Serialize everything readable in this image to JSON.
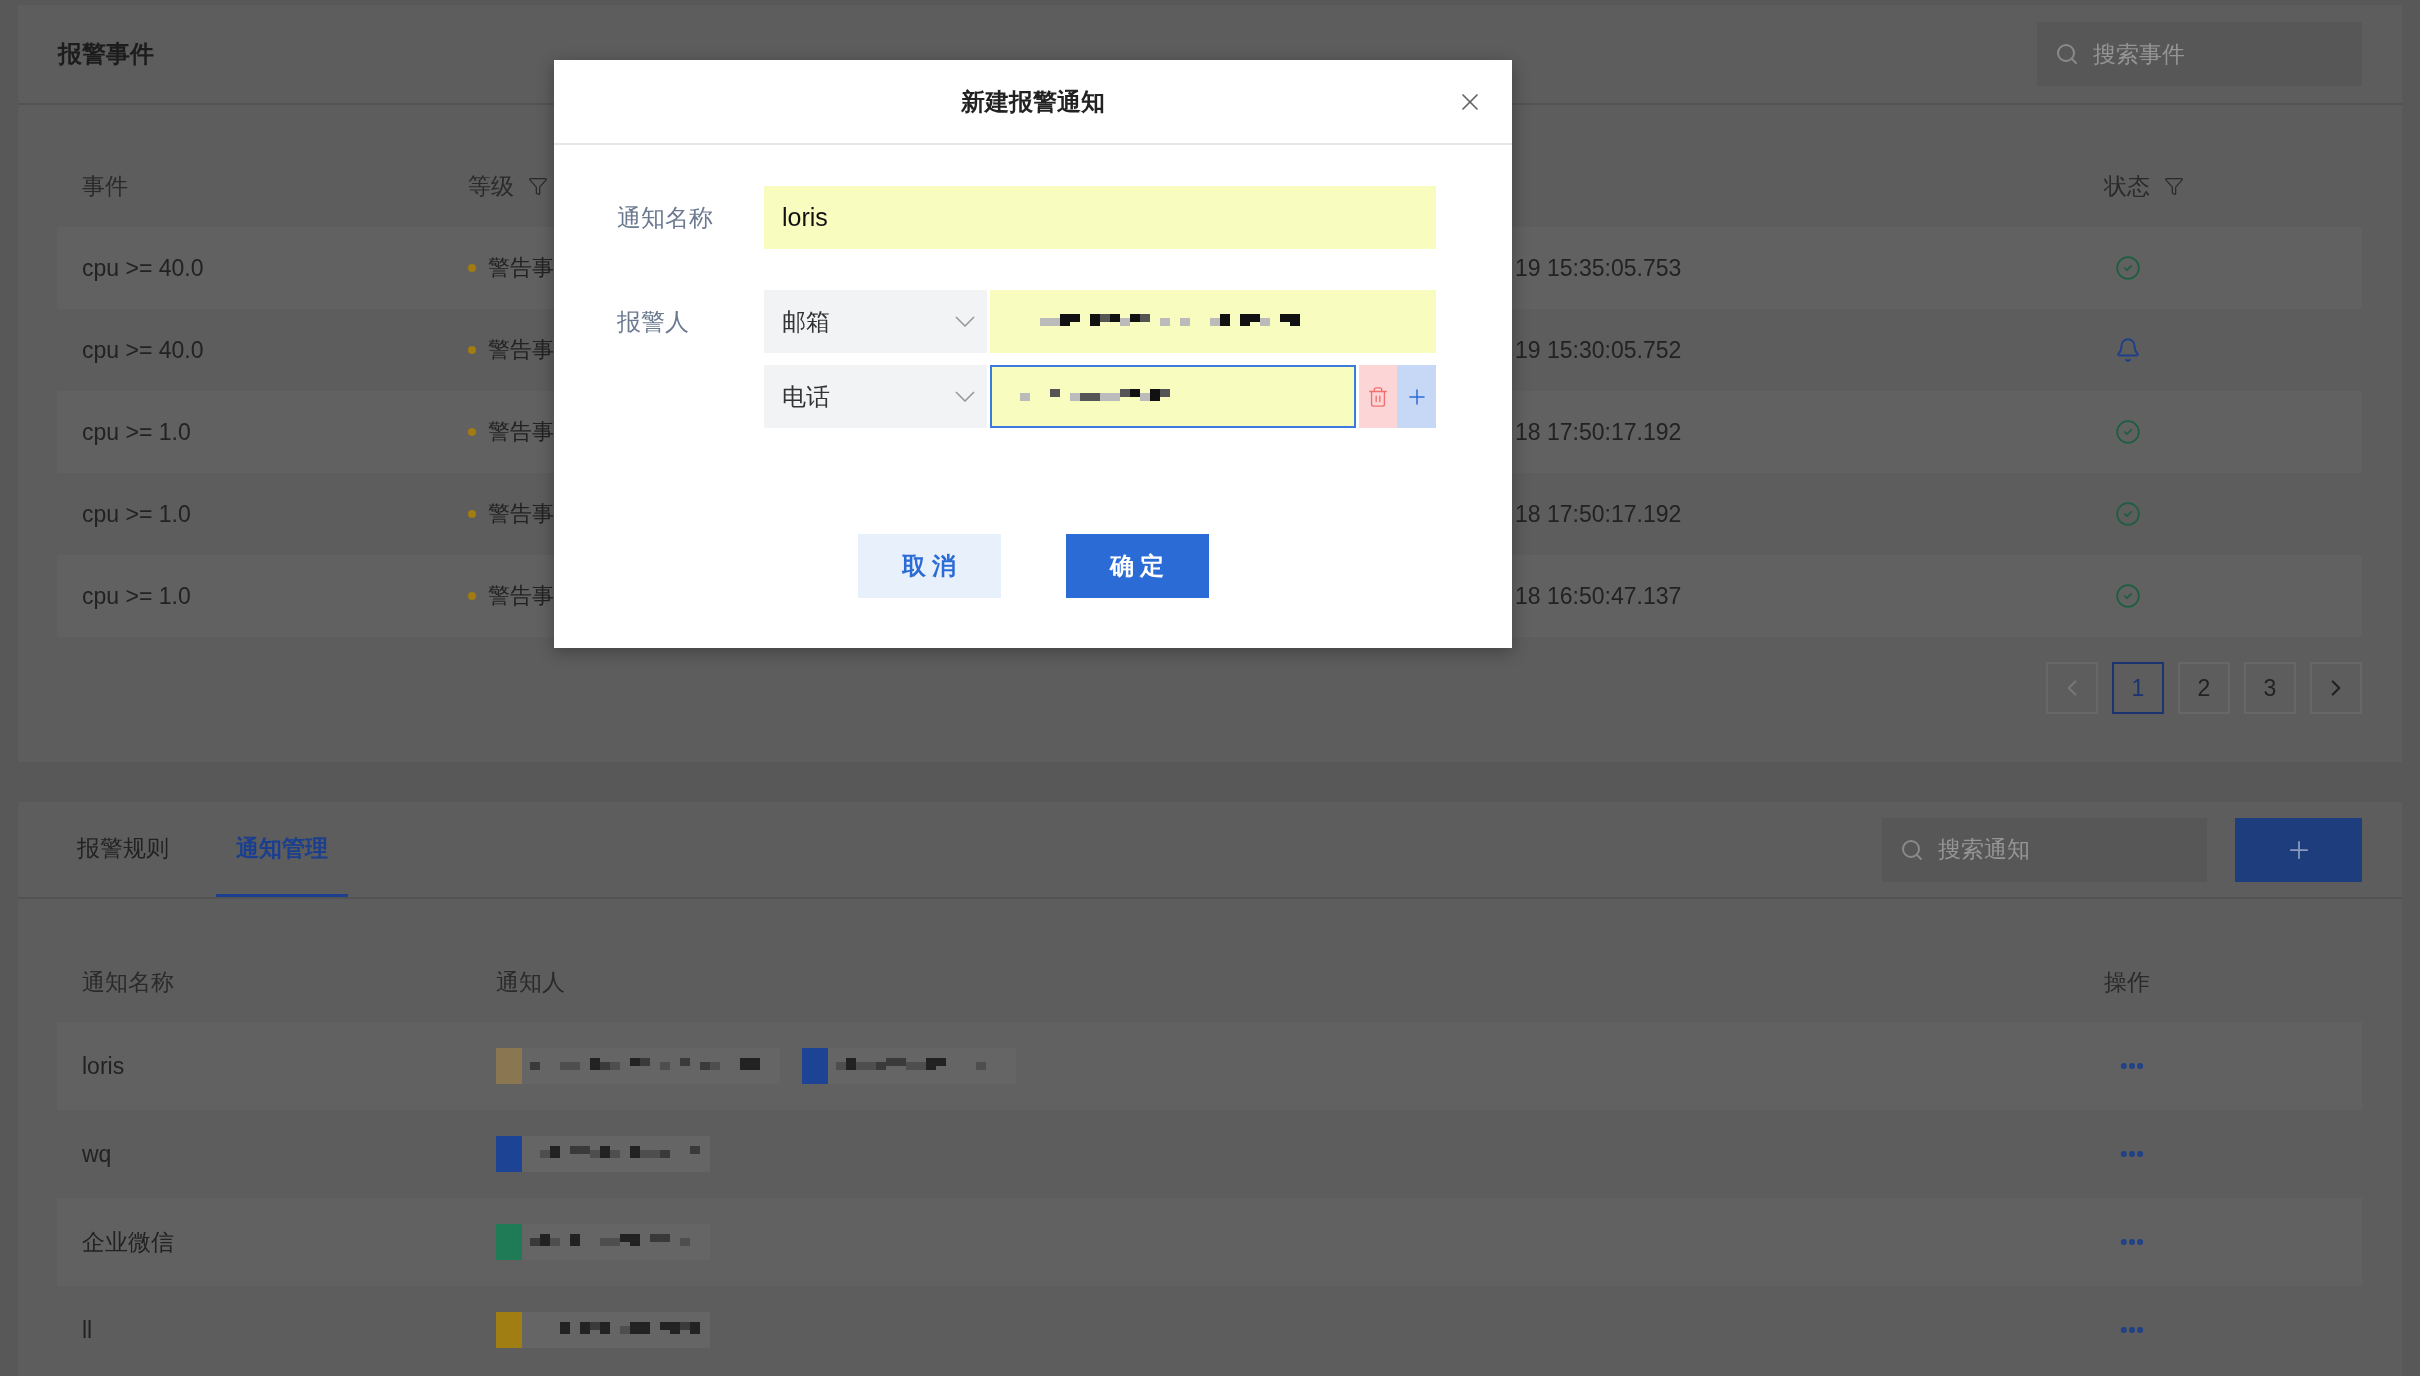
{
  "events_panel": {
    "title": "报警事件",
    "search": {
      "placeholder": "搜索事件"
    },
    "columns": [
      {
        "label": "事件",
        "filter": false
      },
      {
        "label": "等级",
        "filter": true
      },
      {
        "label": "状态",
        "filter": true
      }
    ],
    "rows": [
      {
        "event": "cpu >= 40.0",
        "level": "警告事",
        "color": "#a27b12",
        "time": "19 15:35:05.753",
        "kind": "resolved"
      },
      {
        "event": "cpu >= 40.0",
        "level": "警告事",
        "color": "#a27b12",
        "time": "19 15:30:05.752",
        "kind": "alarm"
      },
      {
        "event": "cpu >= 1.0",
        "level": "警告事",
        "color": "#a27b12",
        "time": "18 17:50:17.192",
        "kind": "resolved"
      },
      {
        "event": "cpu >= 1.0",
        "level": "警告事",
        "color": "#a27b12",
        "time": "18 17:50:17.192",
        "kind": "resolved"
      },
      {
        "event": "cpu >= 1.0",
        "level": "警告事",
        "color": "#a27b12",
        "time": "18 16:50:47.137",
        "kind": "resolved"
      }
    ],
    "pagination": [
      {
        "label": "1",
        "selected": true
      },
      {
        "label": "2",
        "selected": false
      },
      {
        "label": "3",
        "selected": false
      }
    ]
  },
  "notify_panel": {
    "tabs": [
      {
        "label": "报警规则",
        "selected": false
      },
      {
        "label": "通知管理",
        "selected": true
      }
    ],
    "search": {
      "placeholder": "搜索通知"
    },
    "columns": [
      "通知名称",
      "通知人",
      "操作"
    ],
    "rows": [
      {
        "name": "loris",
        "recipients": [
          {
            "color": "#8a7650"
          },
          {
            "color": "#1d4494"
          }
        ]
      },
      {
        "name": "wq",
        "recipients": [
          {
            "color": "#1d4494"
          }
        ]
      },
      {
        "name": "企业微信",
        "recipients": [
          {
            "color": "#1f7a56"
          }
        ]
      },
      {
        "name": "ll",
        "recipients": [
          {
            "color": "#a07e14"
          }
        ]
      }
    ]
  },
  "dialog": {
    "title": "新建报警通知",
    "name_label": "通知名称",
    "name_value": "loris",
    "recipient_label": "报警人",
    "contacts": [
      {
        "channel": "邮箱",
        "focused": false,
        "removable": false
      },
      {
        "channel": "电话",
        "focused": true,
        "removable": true
      }
    ],
    "buttons": [
      {
        "label": "取 消",
        "kind": "secondary"
      },
      {
        "label": "确 定",
        "kind": "primary"
      }
    ]
  }
}
